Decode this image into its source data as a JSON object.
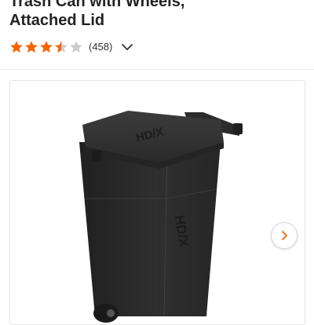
{
  "product": {
    "title_lines": [
      "Trash Can with Wheels,",
      "Attached Lid"
    ]
  },
  "rating": {
    "value": 3.5,
    "max": 5,
    "review_count": "(458)",
    "star_color": "#f96302",
    "empty_star_color": "#cccccc"
  },
  "gallery": {
    "product_image_icon": "trash-can-image",
    "brand_mark": "HD/X",
    "next_icon": "chevron-right-icon"
  },
  "colors": {
    "accent": "#f96302",
    "bin_body": "#2b2b2b",
    "bin_lid": "#333333"
  }
}
